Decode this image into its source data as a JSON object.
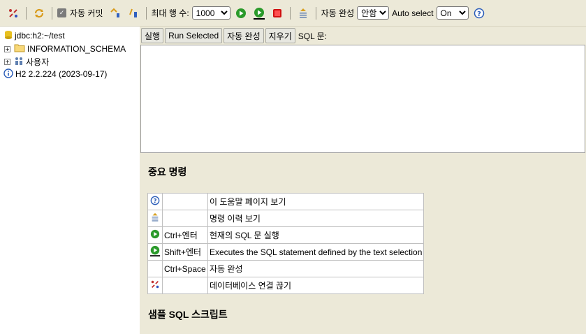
{
  "toolbar": {
    "autocommit_label": "자동 커밋",
    "autocommit_checked": true,
    "max_rows_label": "최대 행 수:",
    "max_rows_value": "1000",
    "autocomplete_label": "자동 완성",
    "autocomplete_value": "안함",
    "autoselect_label": "Auto select",
    "autoselect_value": "On"
  },
  "tree": {
    "items": [
      {
        "label": "jdbc:h2:~/test",
        "icon": "database-icon"
      },
      {
        "label": "INFORMATION_SCHEMA",
        "icon": "folder-icon"
      },
      {
        "label": "사용자",
        "icon": "users-icon"
      },
      {
        "label": "H2 2.2.224 (2023-09-17)",
        "icon": "info-icon"
      }
    ]
  },
  "buttons": {
    "run": "실행",
    "run_selected": "Run Selected",
    "autocomplete": "자동 완성",
    "clear": "지우기",
    "sql_label": "SQL 문:"
  },
  "help": {
    "title": "중요 명령",
    "rows": [
      {
        "icon": "help-icon",
        "key": "",
        "desc": "이 도움말 페이지 보기"
      },
      {
        "icon": "history-icon",
        "key": "",
        "desc": "명령 이력 보기"
      },
      {
        "icon": "run-icon",
        "key": "Ctrl+엔터",
        "desc": "현재의 SQL 문 실행"
      },
      {
        "icon": "run-selected-icon",
        "key": "Shift+엔터",
        "desc": "Executes the SQL statement defined by the text selection"
      },
      {
        "icon": "",
        "key": "Ctrl+Space",
        "desc": "자동 완성"
      },
      {
        "icon": "disconnect-icon",
        "key": "",
        "desc": "데이터베이스 연결 끊기"
      }
    ]
  },
  "sample": {
    "title": "샘플 SQL 스크립트"
  },
  "colors": {
    "toolbar_bg": "#ece9d8",
    "run_green": "#2a9a2a",
    "stop_red": "#d01010"
  }
}
